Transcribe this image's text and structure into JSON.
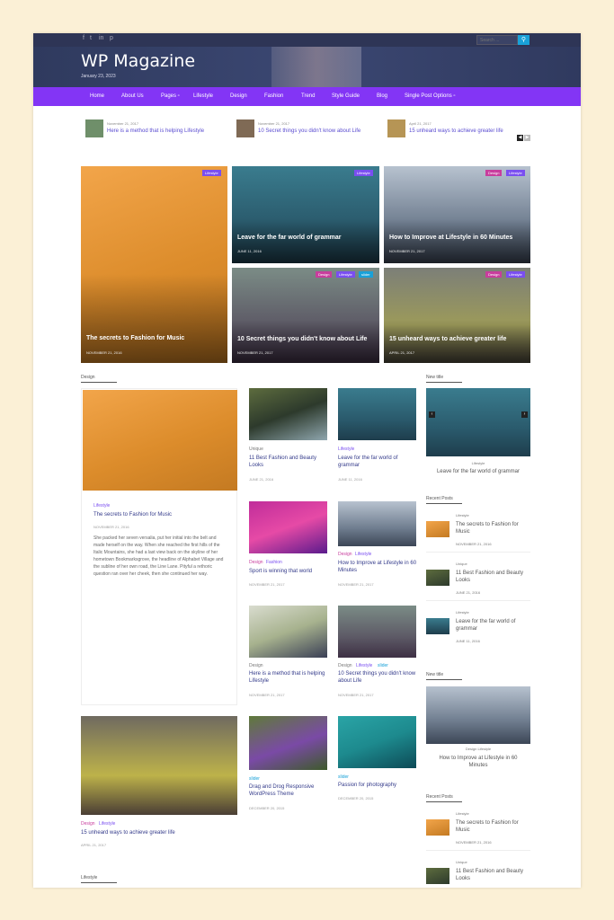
{
  "topbar": {
    "social": [
      "f",
      "t",
      "in",
      "p"
    ],
    "search_placeholder": "Search ...",
    "search_icon": "search-icon"
  },
  "header": {
    "title": "WP Magazine",
    "date": "January 23, 2023"
  },
  "nav": [
    "Home",
    "About Us",
    "Pages ▫",
    "Lifestyle",
    "Design",
    "Fashion",
    "Trend",
    "Style Guide",
    "Blog",
    "Single Post Options ▫"
  ],
  "ticker": [
    {
      "date": "November 21, 2017",
      "title": "Here is a method that is helping Lifestyle",
      "color": "#6f8f6a"
    },
    {
      "date": "November 21, 2017",
      "title": "10 Secret things you didn't know about Life",
      "color": "#7f6a55"
    },
    {
      "date": "April 21, 2017",
      "title": "15 unheard ways to achieve greater life",
      "color": "#b69555"
    }
  ],
  "featured": [
    {
      "title": "The secrets to Fashion for Music",
      "date": "NOVEMBER 21, 2016",
      "badges": [
        "Lifestyle"
      ],
      "bg": "linear-gradient(160deg,#f2a54a,#dc8c2b 55%,#c47a22)"
    },
    {
      "title": "Leave for the far world of grammar",
      "date": "JUNE 11, 2016",
      "badges": [
        "Lifestyle"
      ],
      "bg": "linear-gradient(180deg,#3a7c8e,#2a5a6c 60%,#1e3d4c)"
    },
    {
      "title": "How to Improve at Lifestyle in 60 Minutes",
      "date": "NOVEMBER 21, 2017",
      "badges": [
        "Design",
        "Lifestyle"
      ],
      "bg": "linear-gradient(180deg,#b7c2cf,#6f7d8f 60%,#3c4656)"
    },
    {
      "title": "10 Secret things you didn't know about Life",
      "date": "NOVEMBER 21, 2017",
      "badges": [
        "Design",
        "Lifestyle",
        "slider"
      ],
      "bg": "linear-gradient(180deg,#7b8c86,#5d5a66 60%,#3e3044)"
    },
    {
      "title": "15 unheard ways to achieve greater life",
      "date": "APRIL 21, 2017",
      "badges": [
        "Design",
        "Lifestyle"
      ],
      "bg": "linear-gradient(180deg,#7c7f78,#9c9a5a 60%,#4c473a)"
    }
  ],
  "design_section": {
    "label": "Design",
    "main": {
      "category": "Lifestyle",
      "title": "The secrets to Fashion for Music",
      "date": "NOVEMBER 21, 2016",
      "excerpt": "She packed her seven versalia, put her initial into the belt and made herself on the way. When she reached the first hills of the Italic Mountains, she had a last view back on the skyline of her hometown Bookmarksgrove, the headline of Alphabet Village and the subline of her own road, the Line Lane. Pityful a rethoric question ran over her cheek, then she continued her way."
    },
    "grid": [
      {
        "cats": [
          "Unique"
        ],
        "title": "11 Best Fashion and Beauty Looks",
        "date": "JUNE 21, 2016",
        "bg": "linear-gradient(160deg,#5d6c3e,#2d3a2c 50%,#8fa6ae)"
      },
      {
        "cats": [
          "Lifestyle"
        ],
        "title": "Leave for the far world of grammar",
        "date": "JUNE 11, 2016",
        "bg": "linear-gradient(180deg,#3a7c8e,#2a5a6c 60%,#1e3d4c)"
      },
      {
        "cats": [
          "Design",
          "Fashion"
        ],
        "title": "Sport is winning that world",
        "date": "NOVEMBER 21, 2017",
        "bg": "linear-gradient(160deg,#c02d9a,#e64aa6 50%,#5a1b8c)"
      },
      {
        "cats": [
          "Design",
          "Lifestyle"
        ],
        "title": "How to Improve at Lifestyle in 60 Minutes",
        "date": "NOVEMBER 21, 2017",
        "bg": "linear-gradient(180deg,#b7c2cf,#6f7d8f 60%,#3c4656)"
      },
      {
        "cats": [
          "Design"
        ],
        "title": "Here is a method that is helping Lifestyle",
        "date": "NOVEMBER 21, 2017",
        "bg": "linear-gradient(160deg,#d9dccf,#a7b28e 50%,#3a3f55)"
      },
      {
        "cats": [
          "Design",
          "Lifestyle",
          "slider"
        ],
        "title": "10 Secret things you didn't know about Life",
        "date": "NOVEMBER 21, 2017",
        "bg": "linear-gradient(180deg,#7b8c86,#5d5a66 60%,#3e3044)"
      }
    ]
  },
  "lower": [
    {
      "cats": [
        "Design",
        "Lifestyle"
      ],
      "title": "15 unheard ways to achieve greater life",
      "date": "APRIL 21, 2017",
      "bg": "linear-gradient(180deg,#6f6a60,#bdb24a 60%,#4a3e35)"
    },
    {
      "cats": [
        "slider"
      ],
      "title": "Drag and Drog Responsive WordPress Theme",
      "date": "DECEMBER 20, 2015",
      "bg": "linear-gradient(160deg,#5f7a3a,#7a4aa6 55%,#3d5a2a)"
    },
    {
      "cats": [
        "slider"
      ],
      "title": "Passion for photography",
      "date": "DECEMBER 20, 2015",
      "bg": "linear-gradient(160deg,#2aa4a6,#1d8a8e 50%,#0d4a56)"
    }
  ],
  "lifestyle_label": "Lifestyle",
  "sidebar": {
    "newtitle1": {
      "label": "New title",
      "category": "Lifestyle",
      "title": "Leave for the far world of grammar",
      "bg": "linear-gradient(180deg,#3a7c8e,#2a5a6c 60%,#1e3d4c)"
    },
    "recent1": {
      "label": "Recent Posts",
      "items": [
        {
          "cat": "Lifestyle",
          "title": "The secrets to Fashion for Music",
          "date": "NOVEMBER 21, 2016",
          "bg": "linear-gradient(160deg,#f2a54a,#c47a22)"
        },
        {
          "cat": "Unique",
          "title": "11 Best Fashion and Beauty Looks",
          "date": "JUNE 21, 2016",
          "bg": "linear-gradient(160deg,#5d6c3e,#2d3a2c)"
        },
        {
          "cat": "Lifestyle",
          "title": "Leave for the far world of grammar",
          "date": "JUNE 11, 2016",
          "bg": "linear-gradient(180deg,#3a7c8e,#1e3d4c)"
        }
      ]
    },
    "newtitle2": {
      "label": "New title",
      "category": "Design Lifestyle",
      "title": "How to Improve at Lifestyle in 60 Minutes",
      "bg": "linear-gradient(180deg,#b7c2cf,#6f7d8f 60%,#3c4656)"
    },
    "recent2": {
      "label": "Recent Posts",
      "items": [
        {
          "cat": "Lifestyle",
          "title": "The secrets to Fashion for Music",
          "date": "NOVEMBER 21, 2016",
          "bg": "linear-gradient(160deg,#f2a54a,#c47a22)"
        },
        {
          "cat": "Unique",
          "title": "11 Best Fashion and Beauty Looks",
          "date": "",
          "bg": "linear-gradient(160deg,#5d6c3e,#2d3a2c)"
        }
      ]
    }
  },
  "colors": {
    "nav": "#8335f5",
    "badge_lifestyle": "#7a4ef0",
    "badge_design": "#c83d9d",
    "badge_slider": "#19a1d8",
    "header": "#2f3a5e"
  }
}
